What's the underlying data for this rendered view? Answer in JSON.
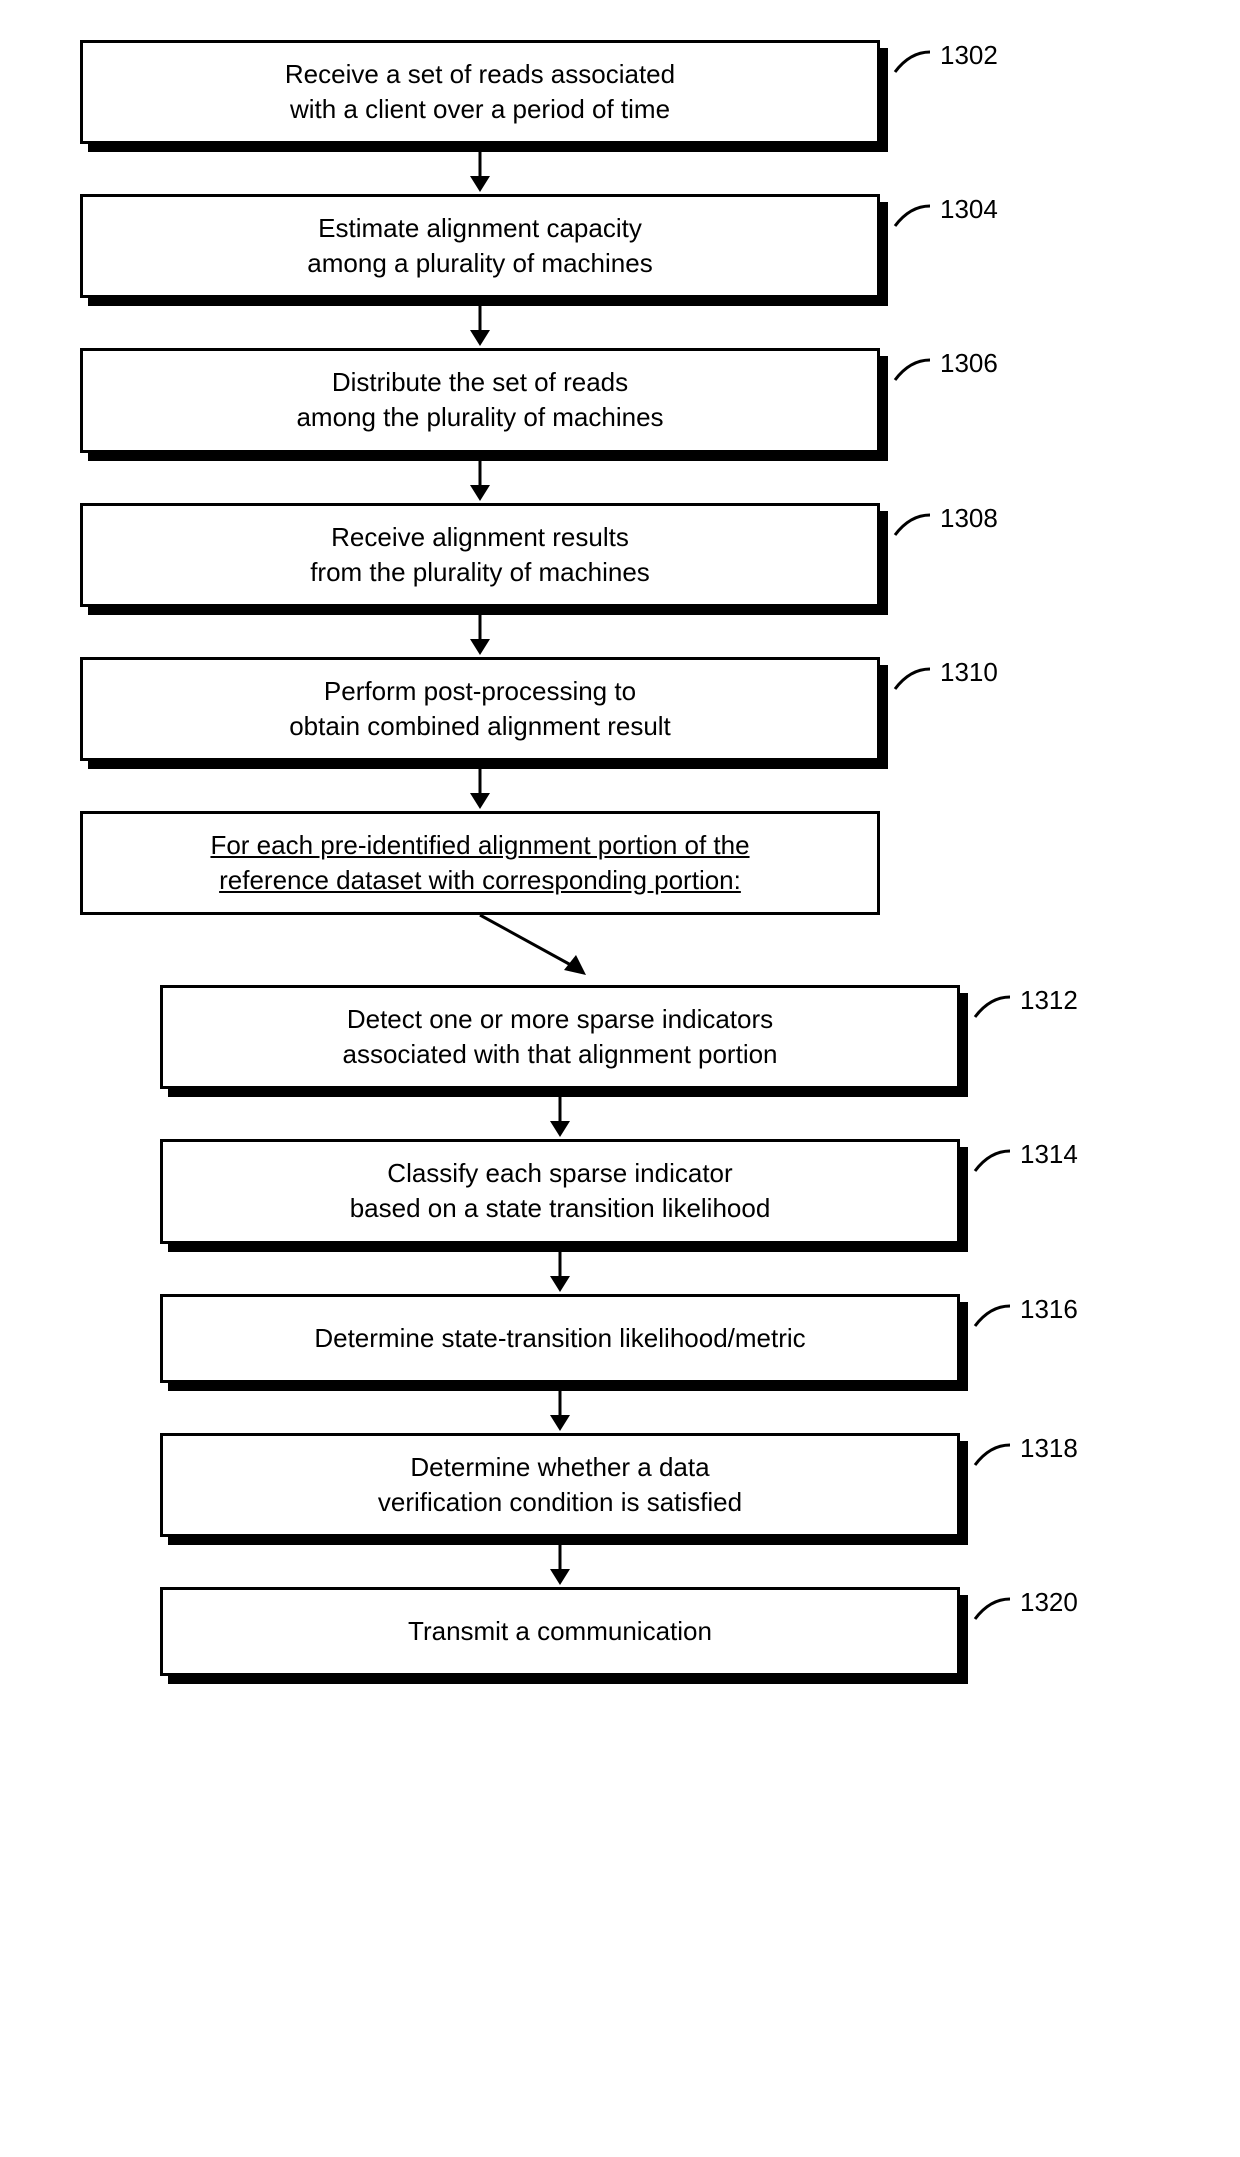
{
  "steps": {
    "s1": {
      "ref": "1302",
      "l1": "Receive a set of reads associated",
      "l2": "with a client over a period of time"
    },
    "s2": {
      "ref": "1304",
      "l1": "Estimate alignment capacity",
      "l2": "among a plurality of machines"
    },
    "s3": {
      "ref": "1306",
      "l1": "Distribute the set of reads",
      "l2": "among the plurality of machines"
    },
    "s4": {
      "ref": "1308",
      "l1": "Receive alignment results",
      "l2": "from the plurality of machines"
    },
    "s5": {
      "ref": "1310",
      "l1": "Perform post-processing to",
      "l2": "obtain combined alignment result"
    },
    "loop": {
      "l1": "For each pre-identified alignment portion of the",
      "l2": "reference dataset with corresponding portion:"
    },
    "s6": {
      "ref": "1312",
      "l1": "Detect one or more sparse indicators",
      "l2": "associated with that alignment portion"
    },
    "s7": {
      "ref": "1314",
      "l1": "Classify each sparse indicator",
      "l2": "based on a state transition likelihood"
    },
    "s8": {
      "ref": "1316",
      "l1": "Determine state-transition likelihood/metric"
    },
    "s9": {
      "ref": "1318",
      "l1": "Determine whether a data",
      "l2": "verification condition is satisfied"
    },
    "s10": {
      "ref": "1320",
      "l1": "Transmit a communication"
    }
  }
}
